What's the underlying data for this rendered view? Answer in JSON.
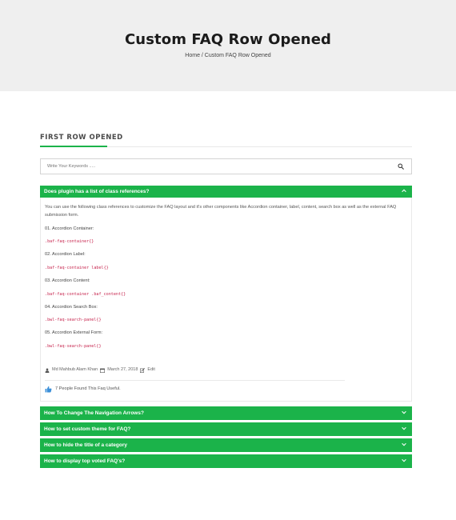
{
  "hero": {
    "title": "Custom FAQ Row Opened",
    "breadcrumb": "Home / Custom FAQ Row Opened"
  },
  "section": {
    "title": "FIRST ROW OPENED"
  },
  "search": {
    "placeholder": "Write Your Keywords .....",
    "icon": "search-icon"
  },
  "open_faq": {
    "question": "Does plugin has a list of class references?",
    "intro": "You can use the following class references to customize the FAQ layout and it's other components like Accordion container, label, content, search box as well as the external FAQ submission form.",
    "items": [
      {
        "label": "01. Accordion Container:",
        "code": ".baf-faq-container{}"
      },
      {
        "label": "02. Accordion Label:",
        "code": ".baf-faq-container label{}"
      },
      {
        "label": "03. Accordion Content:",
        "code": ".baf-faq-container .baf_content{}"
      },
      {
        "label": "04. Accordion Search Box:",
        "code": ".bwl-faq-search-panel{}"
      },
      {
        "label": "05. Accordion External Form:",
        "code": ".bwl-faq-search-panel{}"
      }
    ],
    "author": "Md Mahbub Alam Khan",
    "date": "March 27, 2018",
    "edit": "Edit",
    "useful": "7 People Found This Faq Useful."
  },
  "collapsed_faqs": [
    "How To Change The Navigation Arrows?",
    "How to set custom theme for FAQ?",
    "How to hide the title of a category",
    "How to display top voted FAQ's?"
  ],
  "colors": {
    "accent": "#1bb34a",
    "code": "#c7254e",
    "hero_bg": "#efefef"
  }
}
